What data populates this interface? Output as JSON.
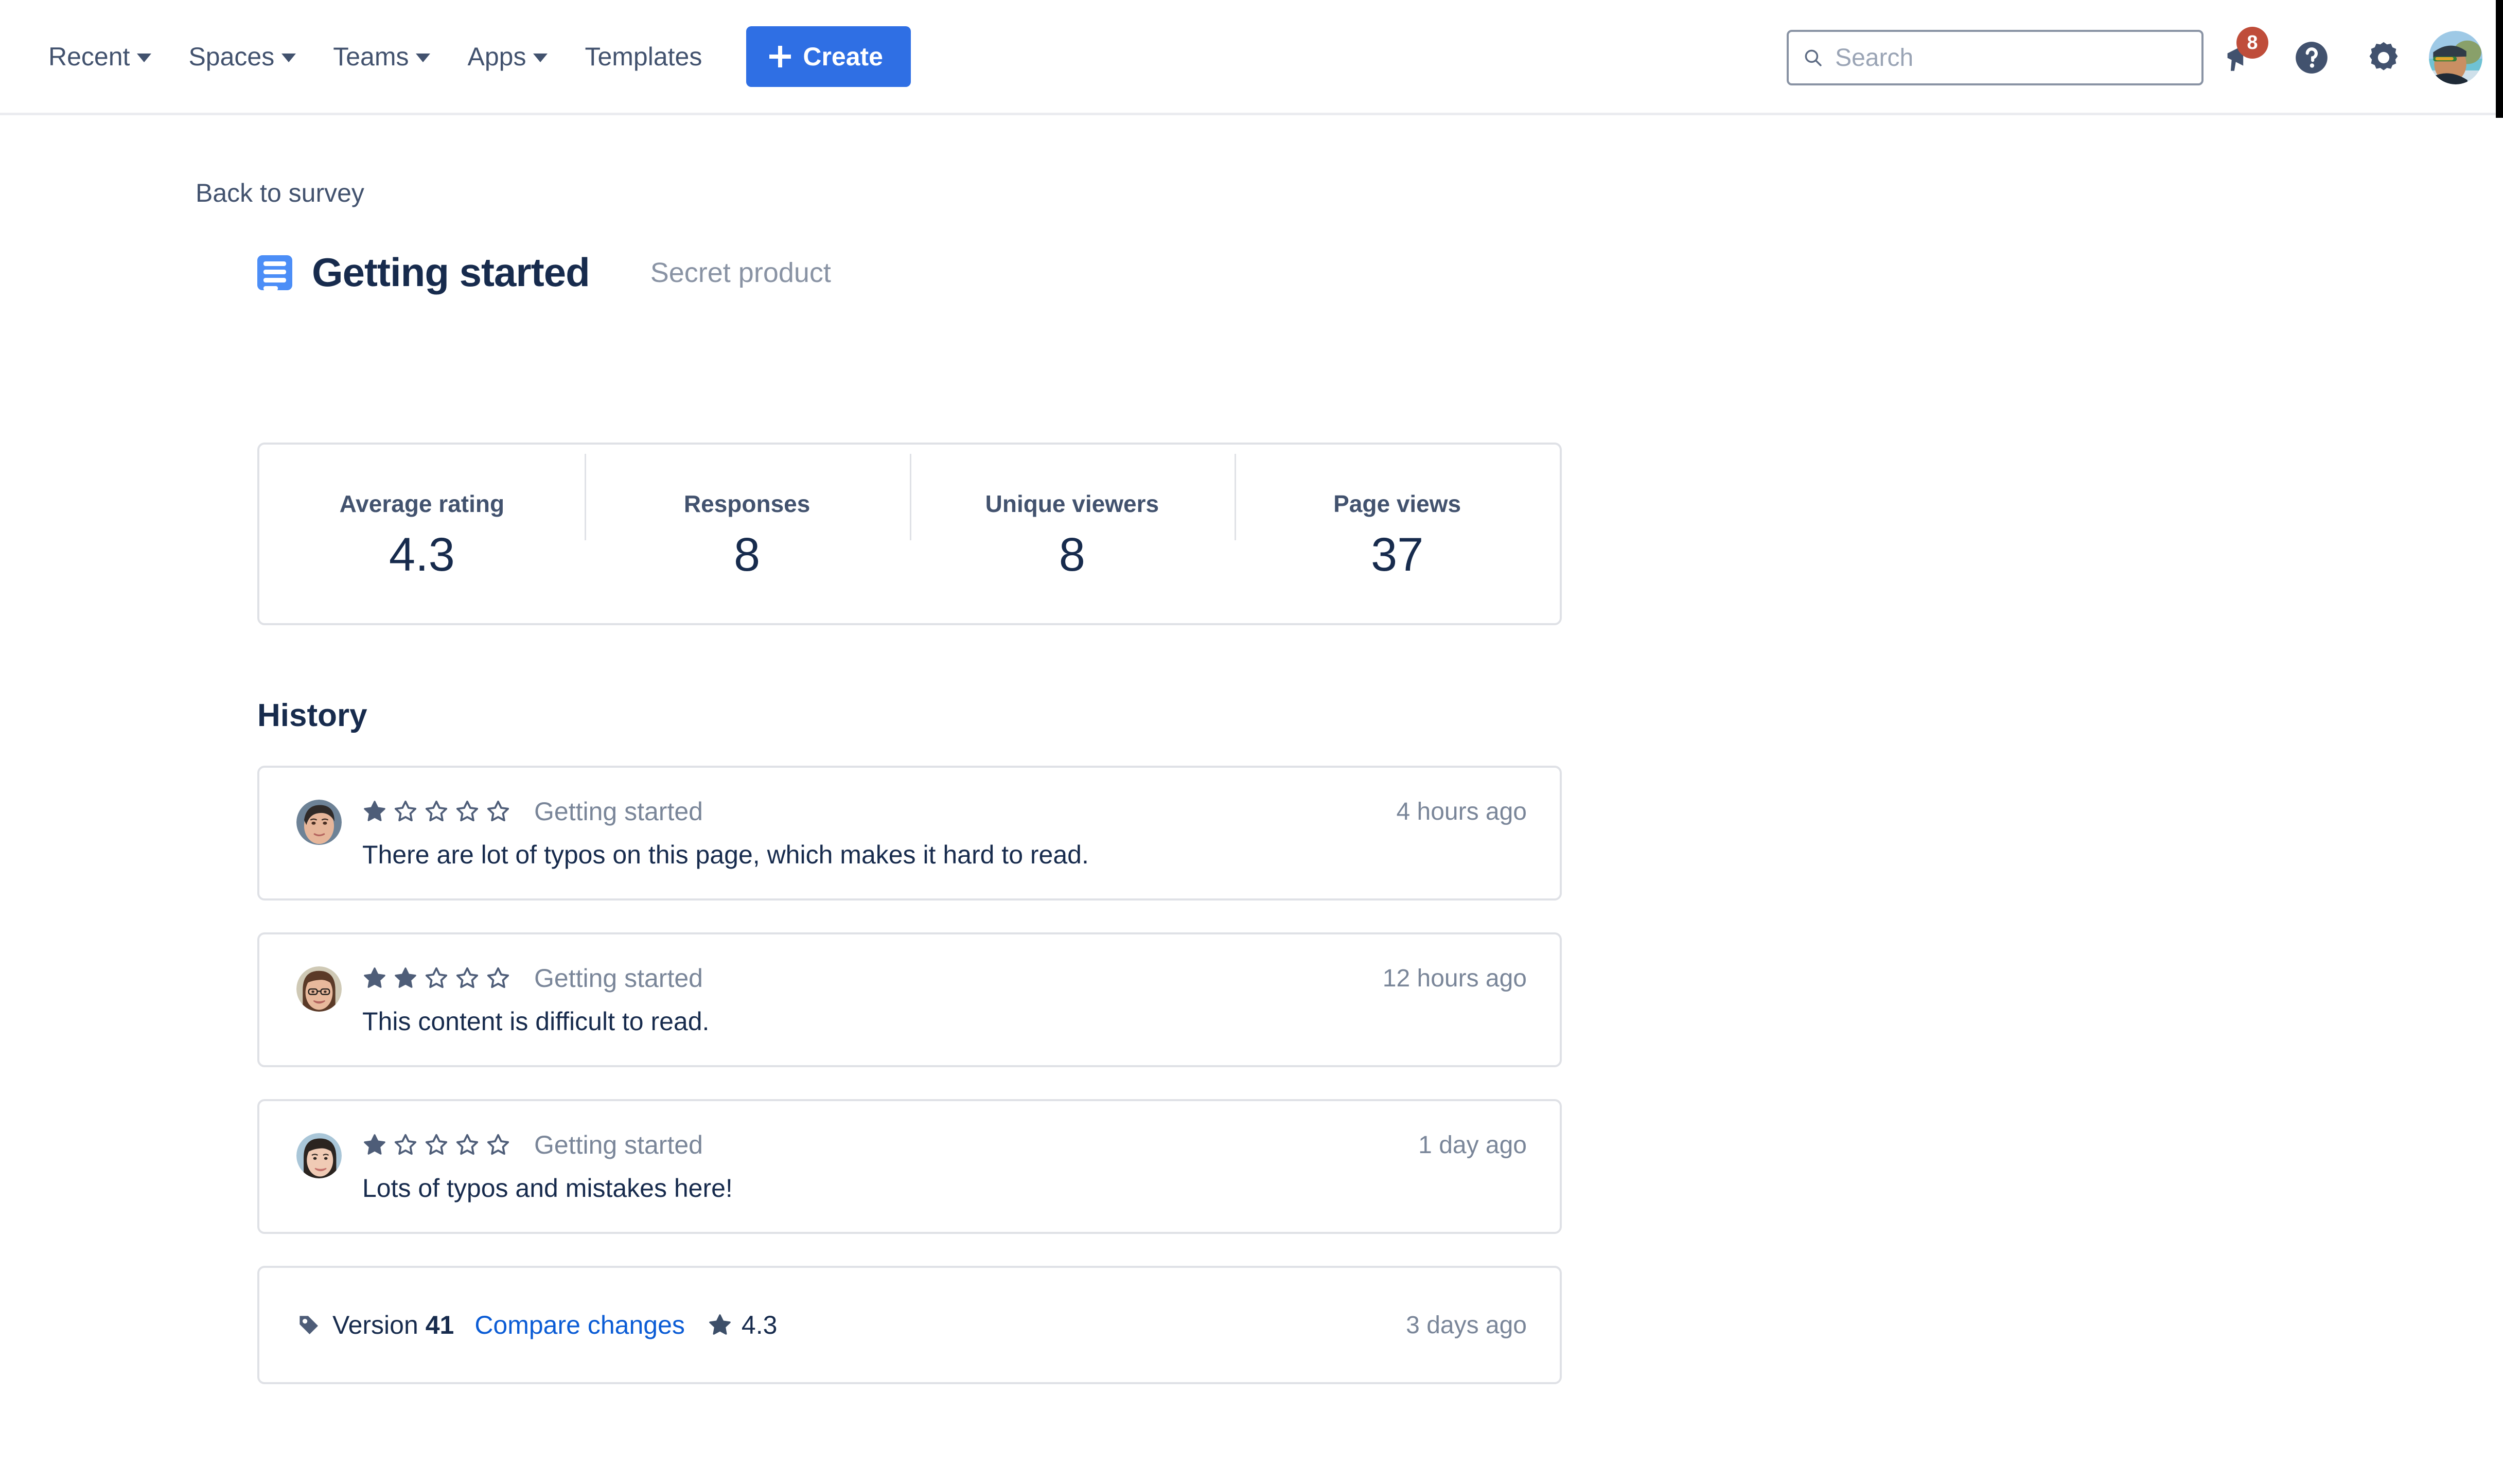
{
  "nav": {
    "items": [
      {
        "label": "Recent",
        "has_caret": true
      },
      {
        "label": "Spaces",
        "has_caret": true
      },
      {
        "label": "Teams",
        "has_caret": true
      },
      {
        "label": "Apps",
        "has_caret": true
      },
      {
        "label": "Templates",
        "has_caret": false
      }
    ],
    "create_label": "Create",
    "search_placeholder": "Search",
    "search_value": "",
    "notification_count": "8",
    "icons": {
      "search": "search-icon",
      "notifications": "megaphone-icon",
      "help": "help-circle-icon",
      "settings": "gear-icon",
      "profile": "user-avatar"
    }
  },
  "page": {
    "back_link": "Back to survey",
    "title": "Getting started",
    "subtitle": "Secret product",
    "icon": "page-document-icon"
  },
  "stats": [
    {
      "label": "Average rating",
      "value": "4.3"
    },
    {
      "label": "Responses",
      "value": "8"
    },
    {
      "label": "Unique viewers",
      "value": "8"
    },
    {
      "label": "Page views",
      "value": "37"
    }
  ],
  "history": {
    "heading": "History",
    "reviews": [
      {
        "rating": 1,
        "max_rating": 5,
        "page_name": "Getting started",
        "time": "4 hours ago",
        "comment": "There are lot of typos on this page, which makes it hard to read.",
        "avatar_colors": [
          "#6d8296",
          "#2f2a28",
          "#e6b69a"
        ]
      },
      {
        "rating": 2,
        "max_rating": 5,
        "page_name": "Getting started",
        "time": "12 hours ago",
        "comment": "This content is difficult to read.",
        "avatar_colors": [
          "#cfc9b5",
          "#5b3a28",
          "#e8b99c"
        ]
      },
      {
        "rating": 1,
        "max_rating": 5,
        "page_name": "Getting started",
        "time": "1 day ago",
        "comment": "Lots of typos and mistakes here!",
        "avatar_colors": [
          "#a9c6d8",
          "#2b2420",
          "#f0cbb5"
        ]
      }
    ],
    "version_row": {
      "version_word": "Version",
      "version_number": "41",
      "compare_link": "Compare changes",
      "rating": "4.3",
      "time": "3 days ago",
      "tag_icon": "tag-icon",
      "star_icon": "star-filled-icon"
    }
  },
  "colors": {
    "brand_blue": "#2f6fe4",
    "link_blue": "#0b5cd5",
    "text_dark": "#172b4d",
    "text_muted": "#7a8699",
    "border": "#dfe1e6",
    "badge_red": "#bf4d3a",
    "page_icon_blue": "#4c8ef7"
  }
}
